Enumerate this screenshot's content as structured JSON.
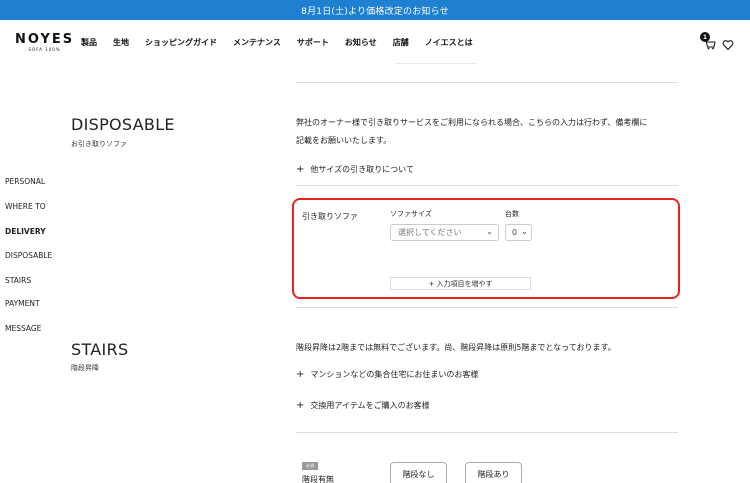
{
  "announcement": "8月1日(土)より価格改定のお知らせ",
  "header": {
    "logo": "NOYES",
    "logo_sub": "SOFA 100%",
    "nav": [
      "製品",
      "生地",
      "ショッピングガイド",
      "メンテナンス",
      "サポート",
      "お知らせ",
      "店舗",
      "ノイエスとは"
    ],
    "cart_count": "1",
    "icons": [
      "cart-icon",
      "heart-icon"
    ]
  },
  "sidebar": {
    "items": [
      "PERSONAL",
      "WHERE TO",
      "DELIVERY",
      "DISPOSABLE",
      "STAIRS",
      "PAYMENT",
      "MESSAGE"
    ],
    "active": "DELIVERY"
  },
  "disposable": {
    "title": "DISPOSABLE",
    "subtitle": "お引き取りソファ",
    "description_line1": "弊社のオーナー様で引き取りサービスをご利用になられる場合、こちらの入力は行わず、備考欄に",
    "description_line2": "記載をお願いいたします。",
    "other_sizes": "他サイズの引き取りについて",
    "form": {
      "label": "引き取りソファ",
      "size_label": "ソファサイズ",
      "size_value": "選択してください",
      "count_label": "台数",
      "count_value": "0",
      "add_button": "+ 入力項目を増やす"
    }
  },
  "stairs": {
    "title": "STAIRS",
    "subtitle": "階段昇降",
    "description": "階段昇降は2階までは無料でございます。尚、階段昇降は原則5階までとなっております。",
    "link1": "マンションなどの集合住宅にお住まいのお客様",
    "link2": "交換用アイテムをご購入のお客様",
    "required_badge": "必須",
    "field_label": "階段有無",
    "options": [
      "階段なし",
      "階段あり"
    ]
  },
  "colors": {
    "announcement_bg": "#1f7fd0",
    "highlight_border": "#e8231f"
  }
}
